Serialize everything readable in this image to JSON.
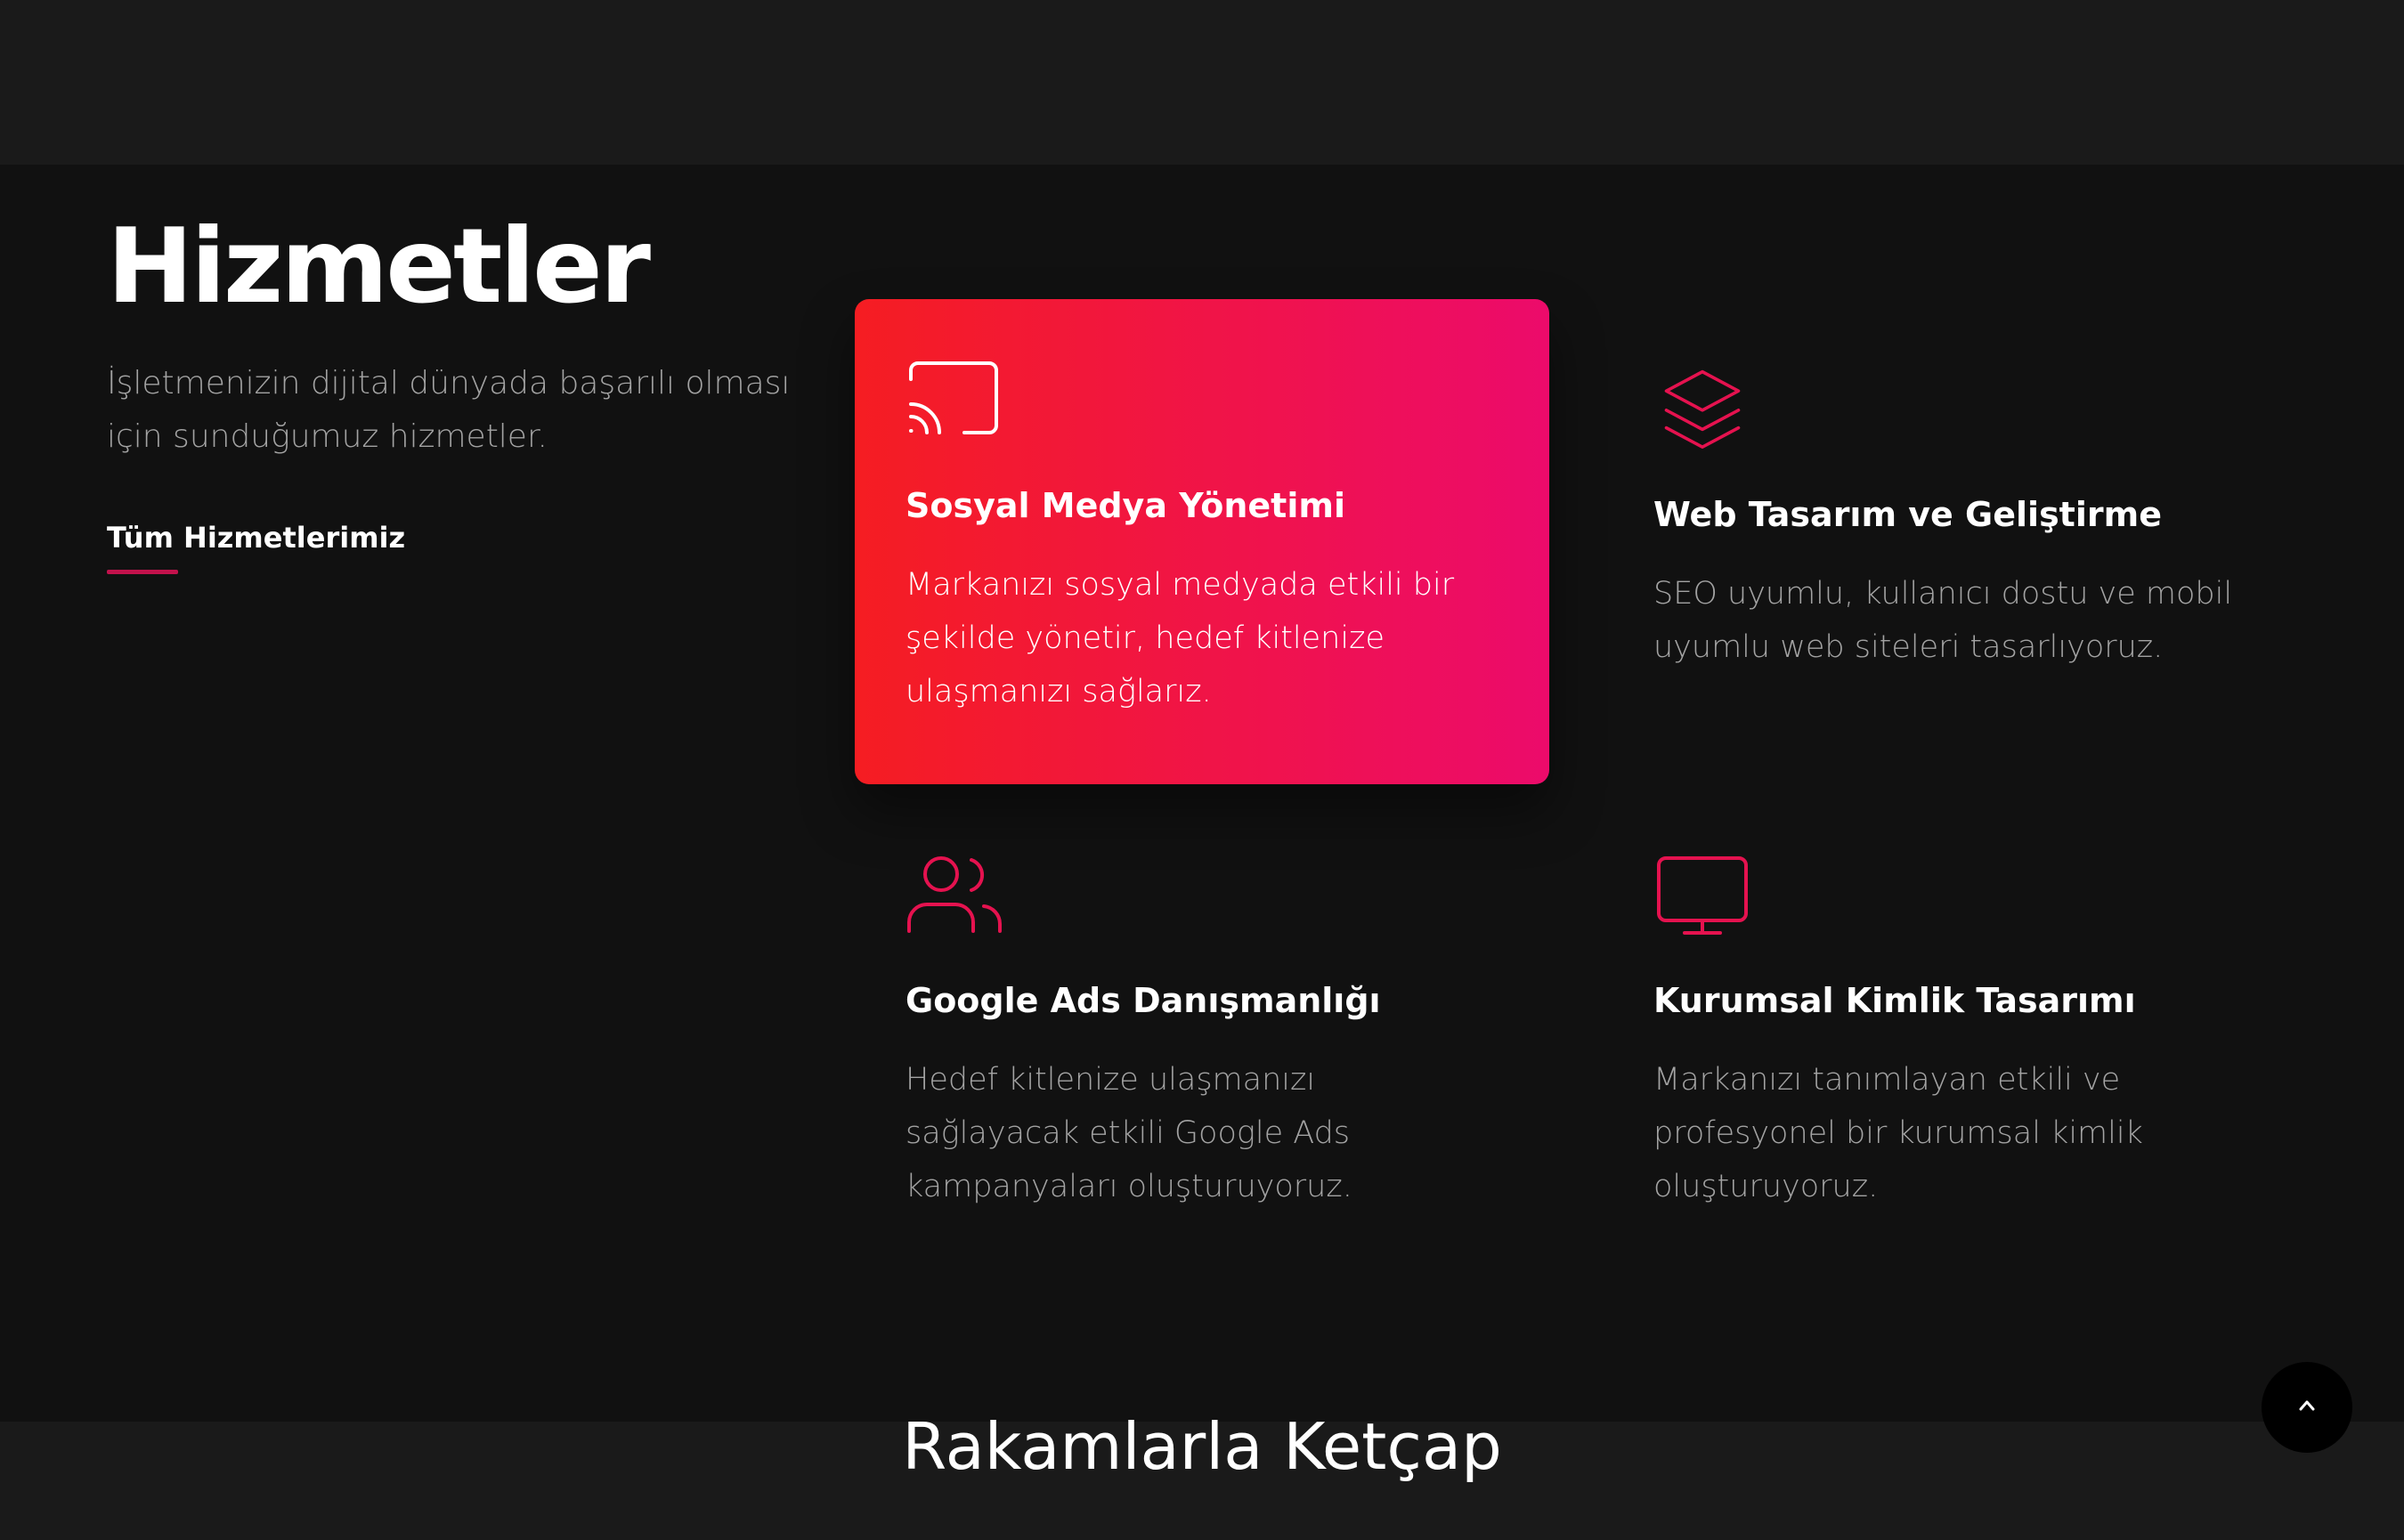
{
  "intro": {
    "title": "Hizmetler",
    "description": "İşletmenizin dijital dünyada başarılı olması için sunduğumuz hizmetler.",
    "link_label": "Tüm Hizmetlerimiz"
  },
  "services": [
    {
      "title": "Sosyal Medya Yönetimi",
      "description": "Markanızı sosyal medyada etkili bir şekilde yönetir, hedef kitlenize ulaşmanızı sağlarız.",
      "icon": "cast-icon",
      "active": true
    },
    {
      "title": "Web Tasarım ve Geliştirme",
      "description": "SEO uyumlu, kullanıcı dostu ve mobil uyumlu web siteleri tasarlıyoruz.",
      "icon": "layers-icon",
      "active": false
    },
    {
      "title": "Google Ads Danışmanlığı",
      "description": "Hedef kitlenize ulaşmanızı sağlayacak etkili Google Ads kampanyaları oluşturuyoruz.",
      "icon": "users-icon",
      "active": false
    },
    {
      "title": "Kurumsal Kimlik Tasarımı",
      "description": "Markanızı tanımlayan etkili ve profesyonel bir kurumsal kimlik oluşturuyoruz.",
      "icon": "monitor-icon",
      "active": false
    }
  ],
  "stats": {
    "title": "Rakamlarla Ketçap"
  },
  "scroll_top": {
    "icon": "chevron-up-icon"
  },
  "colors": {
    "accent": "#e5124f",
    "card_gradient_start": "#f51d22",
    "card_gradient_end": "#ec0b6b",
    "background": "#111111",
    "muted_text": "#a3a3a3"
  }
}
